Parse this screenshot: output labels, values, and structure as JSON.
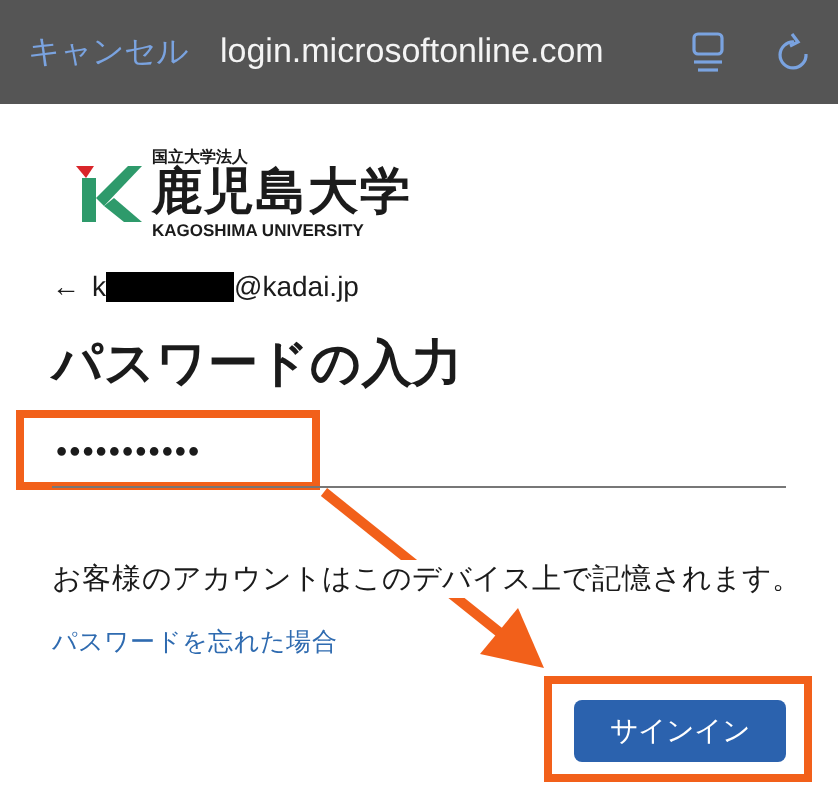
{
  "browser_bar": {
    "cancel": "キャンセル",
    "url": "login.microsoftonline.com"
  },
  "logo": {
    "corporation": "国立大学法人",
    "name": "鹿児島大学",
    "english": "KAGOSHIMA UNIVERSITY"
  },
  "account": {
    "back": "←",
    "user_start": "k",
    "domain": "@kadai.jp"
  },
  "heading": "パスワードの入力",
  "password": {
    "value": "•••••••••••"
  },
  "notice": "お客様のアカウントはこのデバイス上で記憶されます。",
  "forgot_link": "パスワードを忘れた場合",
  "sign_in_button": "サインイン",
  "annotations": [
    {
      "kind": "highlight"
    },
    {
      "kind": "arrow"
    },
    {
      "kind": "highlight"
    }
  ]
}
